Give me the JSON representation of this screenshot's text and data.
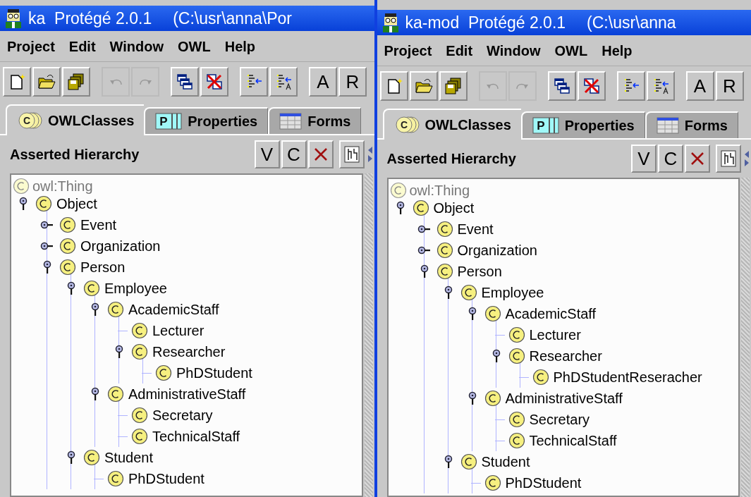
{
  "windows": [
    {
      "title": {
        "app": "ka  Protégé 2.0.1",
        "path": "(C:\\usr\\anna\\Por"
      },
      "menu": [
        "Project",
        "Edit",
        "Window",
        "OWL",
        "Help"
      ],
      "toolbar": [
        {
          "kind": "new",
          "disabled": false
        },
        {
          "kind": "open",
          "disabled": false
        },
        {
          "kind": "save",
          "disabled": false
        },
        {
          "kind": "undo",
          "disabled": true
        },
        {
          "kind": "redo",
          "disabled": true
        },
        {
          "kind": "windows",
          "disabled": false
        },
        {
          "kind": "close-windows",
          "disabled": false
        },
        {
          "kind": "insert",
          "disabled": false
        },
        {
          "kind": "insert-a",
          "disabled": false
        },
        {
          "kind": "text",
          "label": "A",
          "disabled": false
        },
        {
          "kind": "text",
          "label": "R",
          "disabled": false
        }
      ],
      "tabs": [
        {
          "kind": "classes",
          "icon_text": "C",
          "label": "OWLClasses",
          "selected": true
        },
        {
          "kind": "properties",
          "icon_text": "P",
          "label": "Properties",
          "selected": false
        },
        {
          "kind": "forms",
          "label": "Forms",
          "selected": false
        }
      ],
      "hierarchy": {
        "title": "Asserted Hierarchy",
        "buttons": [
          "V",
          "C"
        ]
      },
      "tree": {
        "root": "owl:Thing",
        "items": [
          {
            "label": "Object",
            "expanded": true,
            "children": [
              {
                "label": "Event",
                "expanded": false
              },
              {
                "label": "Organization",
                "expanded": false
              },
              {
                "label": "Person",
                "expanded": true,
                "children": [
                  {
                    "label": "Employee",
                    "expanded": true,
                    "children": [
                      {
                        "label": "AcademicStaff",
                        "expanded": true,
                        "children": [
                          {
                            "label": "Lecturer"
                          },
                          {
                            "label": "Researcher",
                            "expanded": true,
                            "children": [
                              {
                                "label": "PhDStudent"
                              }
                            ]
                          }
                        ]
                      },
                      {
                        "label": "AdministrativeStaff",
                        "expanded": true,
                        "children": [
                          {
                            "label": "Secretary"
                          },
                          {
                            "label": "TechnicalStaff"
                          }
                        ]
                      }
                    ]
                  },
                  {
                    "label": "Student",
                    "expanded": true,
                    "children": [
                      {
                        "label": "PhDStudent"
                      }
                    ]
                  }
                ]
              }
            ]
          }
        ]
      }
    },
    {
      "title": {
        "app": "ka-mod  Protégé 2.0.1",
        "path": "(C:\\usr\\anna"
      },
      "menu": [
        "Project",
        "Edit",
        "Window",
        "OWL",
        "Help"
      ],
      "toolbar": [
        {
          "kind": "new",
          "disabled": false
        },
        {
          "kind": "open",
          "disabled": false
        },
        {
          "kind": "save",
          "disabled": false
        },
        {
          "kind": "undo",
          "disabled": true
        },
        {
          "kind": "redo",
          "disabled": true
        },
        {
          "kind": "windows",
          "disabled": false
        },
        {
          "kind": "close-windows",
          "disabled": false
        },
        {
          "kind": "insert",
          "disabled": false
        },
        {
          "kind": "insert-a",
          "disabled": false
        },
        {
          "kind": "text",
          "label": "A",
          "disabled": false
        },
        {
          "kind": "text",
          "label": "R",
          "disabled": false
        }
      ],
      "tabs": [
        {
          "kind": "classes",
          "icon_text": "C",
          "label": "OWLClasses",
          "selected": true
        },
        {
          "kind": "properties",
          "icon_text": "P",
          "label": "Properties",
          "selected": false
        },
        {
          "kind": "forms",
          "label": "Forms",
          "selected": false
        }
      ],
      "hierarchy": {
        "title": "Asserted Hierarchy",
        "buttons": [
          "V",
          "C"
        ]
      },
      "tree": {
        "root": "owl:Thing",
        "items": [
          {
            "label": "Object",
            "expanded": true,
            "children": [
              {
                "label": "Event",
                "expanded": false
              },
              {
                "label": "Organization",
                "expanded": false
              },
              {
                "label": "Person",
                "expanded": true,
                "children": [
                  {
                    "label": "Employee",
                    "expanded": true,
                    "children": [
                      {
                        "label": "AcademicStaff",
                        "expanded": true,
                        "children": [
                          {
                            "label": "Lecturer"
                          },
                          {
                            "label": "Researcher",
                            "expanded": true,
                            "children": [
                              {
                                "label": "PhDStudentReseracher"
                              }
                            ]
                          }
                        ]
                      },
                      {
                        "label": "AdministrativeStaff",
                        "expanded": true,
                        "children": [
                          {
                            "label": "Secretary"
                          },
                          {
                            "label": "TechnicalStaff"
                          }
                        ]
                      }
                    ]
                  },
                  {
                    "label": "Student",
                    "expanded": true,
                    "children": [
                      {
                        "label": "PhDStudent"
                      }
                    ]
                  }
                ]
              }
            ]
          }
        ]
      }
    }
  ]
}
